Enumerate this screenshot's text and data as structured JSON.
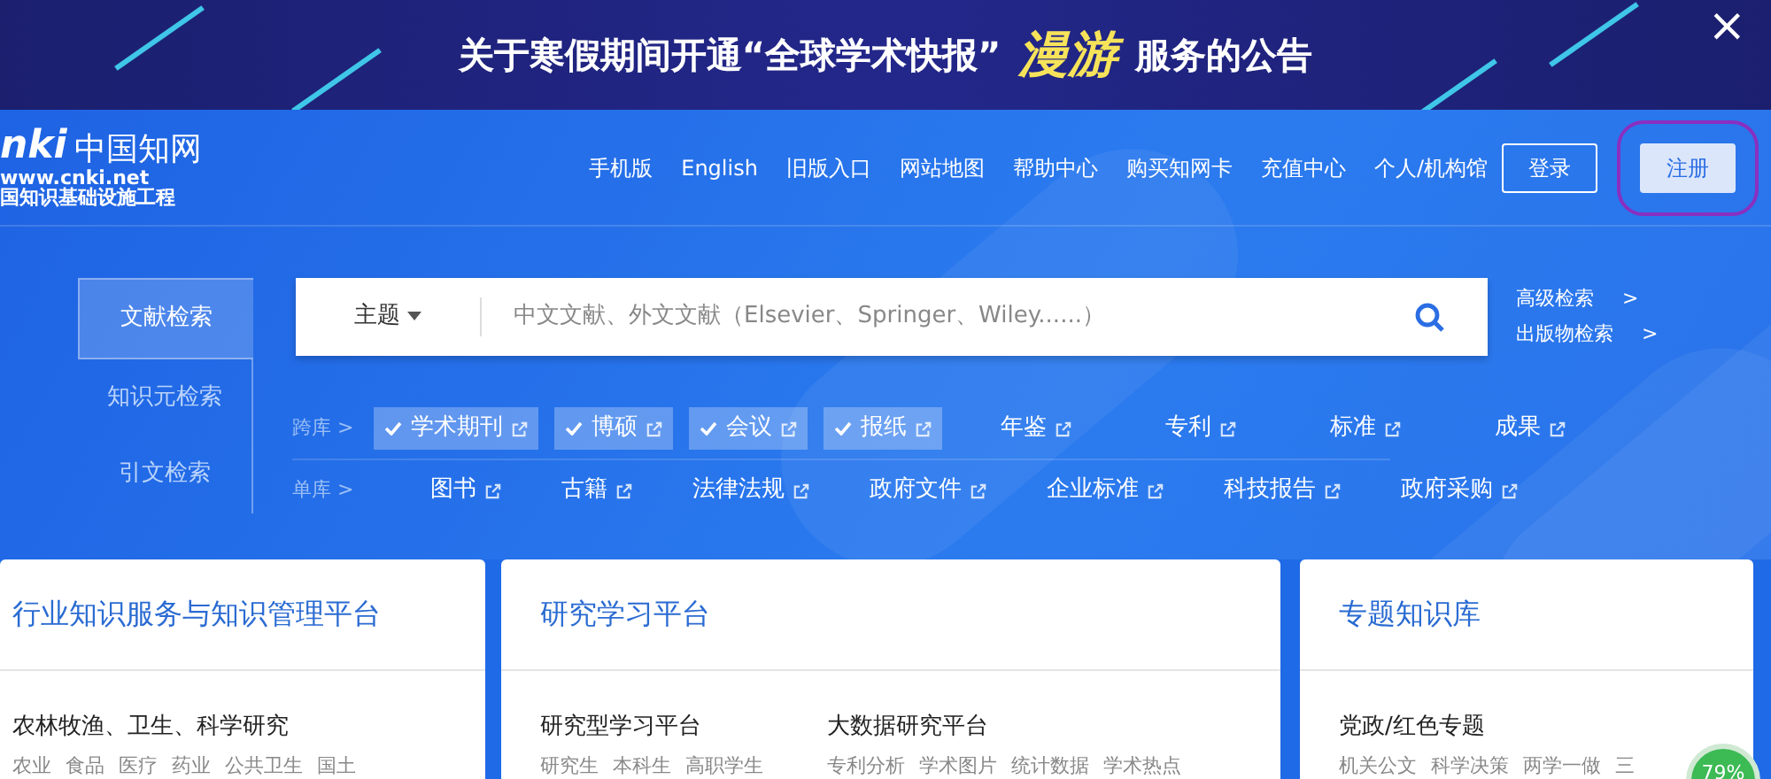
{
  "banner": {
    "text_before": "关于寒假期间开通“全球学术快报”",
    "highlight": "漫游",
    "text_after": "服务的公告",
    "close": "×"
  },
  "logo": {
    "mark": "nki",
    "name": "中国知网",
    "url": "www.cnki.net",
    "slogan": "国知识基础设施工程"
  },
  "nav": [
    "手机版",
    "English",
    "旧版入口",
    "网站地图",
    "帮助中心",
    "购买知网卡",
    "充值中心",
    "个人/机构馆"
  ],
  "account": [
    {
      "label": "登录",
      "kind": "outline",
      "highlighted": false
    },
    {
      "label": "注册",
      "kind": "filled",
      "highlighted": true
    }
  ],
  "search_tabs": [
    {
      "label": "文献检索",
      "selected": true
    },
    {
      "label": "知识元检索",
      "selected": false
    },
    {
      "label": "引文检索",
      "selected": false
    }
  ],
  "search": {
    "field": "主题",
    "placeholder": "中文文献、外文文献（Elsevier、Springer、Wiley......）"
  },
  "side_links": [
    {
      "label": "高级检索",
      "arrow": ">"
    },
    {
      "label": "出版物检索",
      "arrow": ">"
    }
  ],
  "cross_db": {
    "label": "跨库 >",
    "items": [
      {
        "label": "学术期刊",
        "selected": true
      },
      {
        "label": "博硕",
        "selected": true
      },
      {
        "label": "会议",
        "selected": true
      },
      {
        "label": "报纸",
        "selected": true
      },
      {
        "label": "年鉴",
        "selected": false
      },
      {
        "label": "专利",
        "selected": false
      },
      {
        "label": "标准",
        "selected": false
      },
      {
        "label": "成果",
        "selected": false
      }
    ]
  },
  "single_db": {
    "label": "单库 >",
    "items": [
      "图书",
      "古籍",
      "法律法规",
      "政府文件",
      "企业标准",
      "科技报告",
      "政府采购"
    ]
  },
  "cards": [
    {
      "title": "行业知识服务与知识管理平台",
      "groups": [
        {
          "heading": "农林牧渔、卫生、科学研究",
          "tags": [
            "农业",
            "食品",
            "医疗",
            "药业",
            "公共卫生",
            "国土"
          ]
        }
      ]
    },
    {
      "title": "研究学习平台",
      "groups": [
        {
          "heading": "研究型学习平台",
          "tags": [
            "研究生",
            "本科生",
            "高职学生"
          ]
        },
        {
          "heading": "大数据研究平台",
          "tags": [
            "专利分析",
            "学术图片",
            "统计数据",
            "学术热点"
          ]
        }
      ]
    },
    {
      "title": "专题知识库",
      "groups": [
        {
          "heading": "党政/红色专题",
          "tags": [
            "机关公文",
            "科学决策",
            "两学一做",
            "三"
          ]
        }
      ]
    }
  ],
  "widget": {
    "text": "79%"
  }
}
